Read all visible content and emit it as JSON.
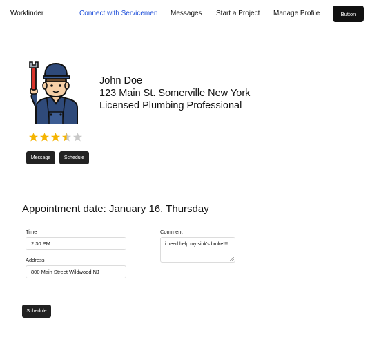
{
  "nav": {
    "brand": "Workfinder",
    "links": [
      "Connect with Servicemen",
      "Messages",
      "Start a Project",
      "Manage Profile"
    ],
    "active_link": "Connect with Servicemen",
    "button_label": "Button"
  },
  "profile": {
    "avatar_icon": "plumber-avatar-icon",
    "name": "John Doe",
    "address": "123 Main St. Somerville New York",
    "title": "Licensed Plumbing Professional",
    "rating": 3.5,
    "rating_max": 5,
    "star_color": "#f5b400",
    "star_empty_color": "#c8c8c8",
    "message_button": "Message",
    "schedule_button": "Schedule"
  },
  "appointment": {
    "heading": "Appointment date: January 16, Thursday",
    "time_label": "Time",
    "time_value": "2:30 PM",
    "address_label": "Address",
    "address_value": "800 Main Street Wildwood NJ",
    "comment_label": "Comment",
    "comment_value": "i need help my sink's broke!!!!",
    "schedule_button": "Schedule"
  },
  "colors": {
    "accent": "#1d4ed8",
    "button_dark": "#111111"
  }
}
